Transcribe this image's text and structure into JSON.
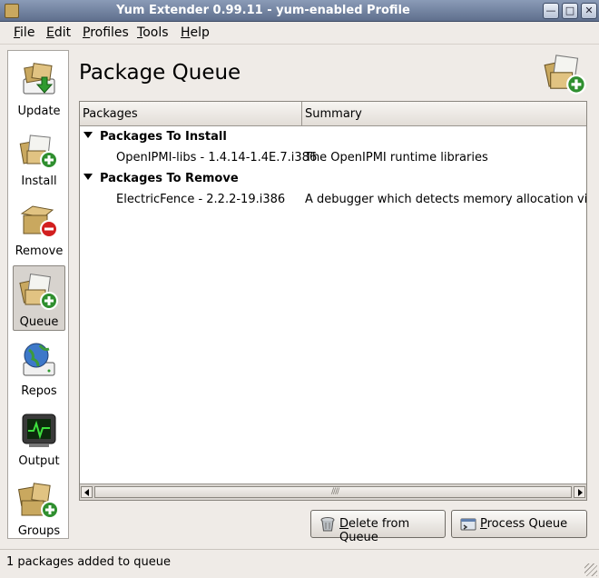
{
  "window": {
    "title": "Yum Extender 0.99.11 - yum-enabled Profile",
    "controls": [
      "minimize",
      "maximize",
      "close"
    ]
  },
  "menu": [
    "File",
    "Edit",
    "Profiles",
    "Tools",
    "Help"
  ],
  "sidebar": {
    "items": [
      {
        "label": "Update",
        "icon": "update-icon"
      },
      {
        "label": "Install",
        "icon": "install-icon"
      },
      {
        "label": "Remove",
        "icon": "remove-icon"
      },
      {
        "label": "Queue",
        "icon": "queue-icon",
        "active": true
      },
      {
        "label": "Repos",
        "icon": "repos-icon"
      },
      {
        "label": "Output",
        "icon": "output-icon"
      },
      {
        "label": "Groups",
        "icon": "groups-icon"
      }
    ]
  },
  "page": {
    "title": "Package Queue"
  },
  "tree": {
    "columns": [
      "Packages",
      "Summary"
    ],
    "groups": [
      {
        "label": "Packages To Install",
        "items": [
          {
            "name": "OpenIPMI-libs - 1.4.14-1.4E.7.i386",
            "summary": "The OpenIPMI runtime libraries"
          }
        ]
      },
      {
        "label": "Packages To Remove",
        "items": [
          {
            "name": "ElectricFence - 2.2.2-19.i386",
            "summary": "A debugger which detects memory allocation violations."
          }
        ]
      }
    ]
  },
  "buttons": {
    "delete": "Delete from Queue",
    "process": "Process Queue"
  },
  "status": {
    "text": "1 packages added to queue"
  },
  "colors": {
    "titlebar": "#6f7f9c",
    "window_bg": "#efebe7",
    "add_badge": "#2f8f2f",
    "remove_badge": "#d21f1f"
  }
}
